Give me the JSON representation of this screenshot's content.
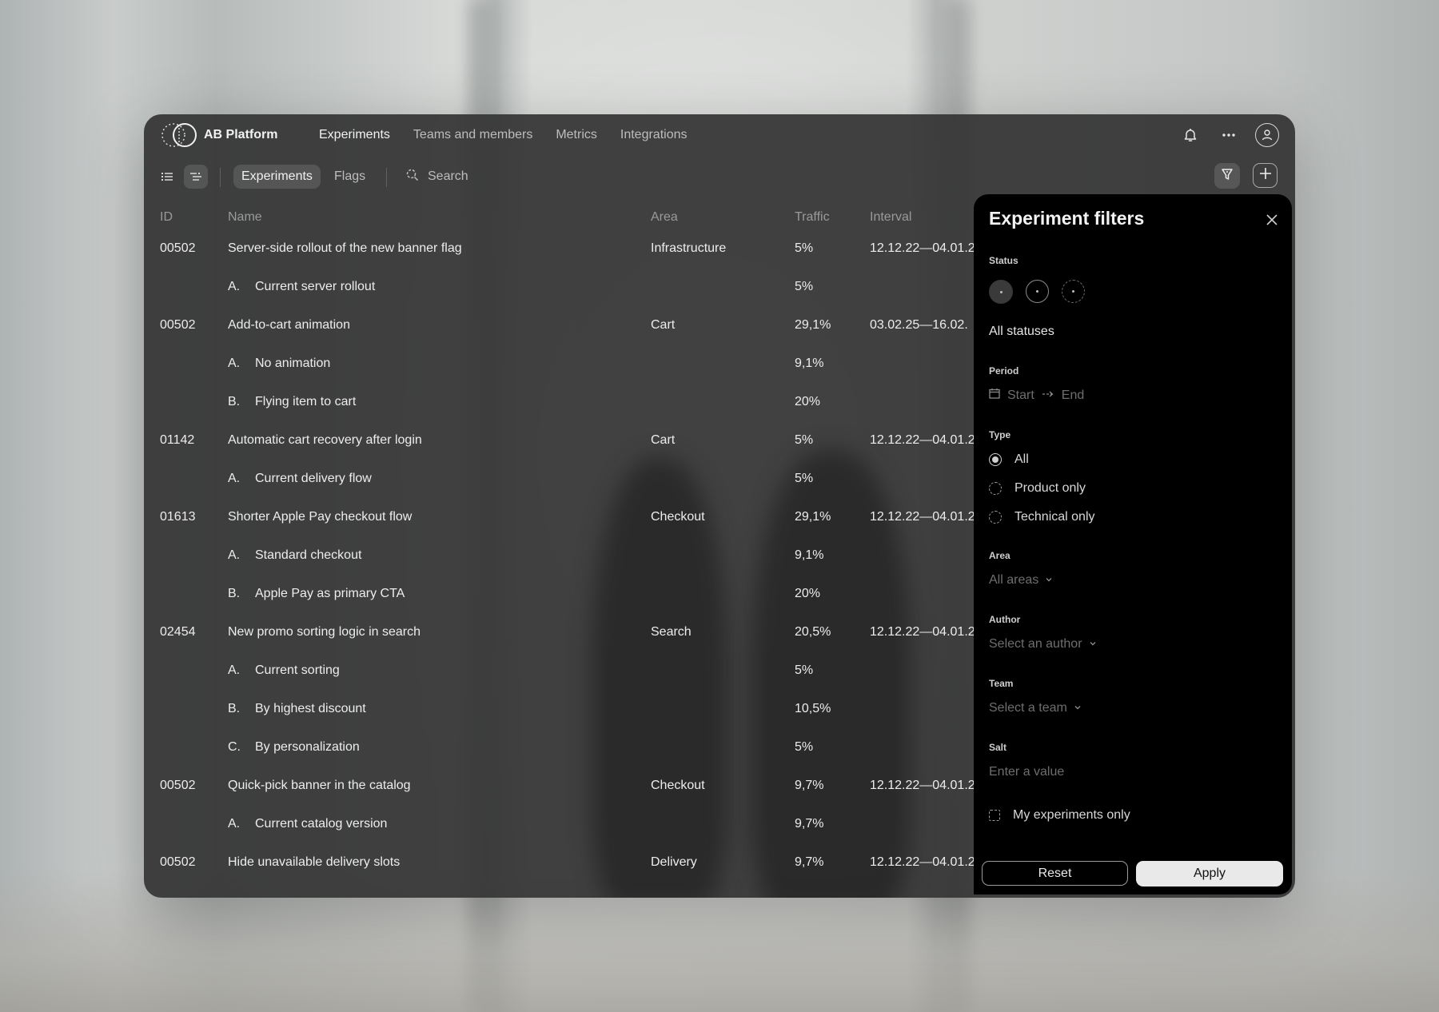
{
  "app": {
    "brand": "AB Platform"
  },
  "nav": {
    "items": [
      "Experiments",
      "Teams and members",
      "Metrics",
      "Integrations"
    ],
    "active": 0
  },
  "toolbar": {
    "segments": [
      "Experiments",
      "Flags"
    ],
    "search_placeholder": "Search"
  },
  "table": {
    "columns": {
      "id": "ID",
      "name": "Name",
      "area": "Area",
      "traffic": "Traffic",
      "interval": "Interval"
    },
    "rows": [
      {
        "type": "experiment",
        "id": "00502",
        "name": "Server-side rollout of the new banner flag",
        "area": "Infrastructure",
        "traffic": "5%",
        "interval": "12.12.22—04.01.2"
      },
      {
        "type": "variant",
        "letter": "A.",
        "name": "Current server rollout",
        "traffic": "5%"
      },
      {
        "type": "experiment",
        "id": "00502",
        "name": "Add-to-cart animation",
        "area": "Cart",
        "traffic": "29,1%",
        "interval": "03.02.25—16.02."
      },
      {
        "type": "variant",
        "letter": "A.",
        "name": "No animation",
        "traffic": "9,1%"
      },
      {
        "type": "variant",
        "letter": "B.",
        "name": "Flying item to cart",
        "traffic": "20%"
      },
      {
        "type": "experiment",
        "id": "01142",
        "name": "Automatic cart recovery after login",
        "area": "Cart",
        "traffic": "5%",
        "interval": "12.12.22—04.01.2"
      },
      {
        "type": "variant",
        "letter": "A.",
        "name": "Current delivery flow",
        "traffic": "5%"
      },
      {
        "type": "experiment",
        "id": "01613",
        "name": "Shorter Apple Pay checkout flow",
        "area": "Checkout",
        "traffic": "29,1%",
        "interval": "12.12.22—04.01.2"
      },
      {
        "type": "variant",
        "letter": "A.",
        "name": "Standard checkout",
        "traffic": "9,1%"
      },
      {
        "type": "variant",
        "letter": "B.",
        "name": "Apple Pay as primary CTA",
        "traffic": "20%"
      },
      {
        "type": "experiment",
        "id": "02454",
        "name": "New promo sorting logic in search",
        "area": "Search",
        "traffic": "20,5%",
        "interval": "12.12.22—04.01.2"
      },
      {
        "type": "variant",
        "letter": "A.",
        "name": "Current sorting",
        "traffic": "5%"
      },
      {
        "type": "variant",
        "letter": "B.",
        "name": "By highest discount",
        "traffic": "10,5%"
      },
      {
        "type": "variant",
        "letter": "C.",
        "name": "By personalization",
        "traffic": "5%"
      },
      {
        "type": "experiment",
        "id": "00502",
        "name": "Quick-pick banner in the catalog",
        "area": "Checkout",
        "traffic": "9,7%",
        "interval": "12.12.22—04.01.2"
      },
      {
        "type": "variant",
        "letter": "A.",
        "name": "Current catalog version",
        "traffic": "9,7%"
      },
      {
        "type": "experiment",
        "id": "00502",
        "name": "Hide unavailable delivery slots",
        "area": "Delivery",
        "traffic": "9,7%",
        "interval": "12.12.22—04.01.2"
      }
    ]
  },
  "filters": {
    "title": "Experiment filters",
    "status": {
      "label": "Status",
      "value": "All statuses"
    },
    "period": {
      "label": "Period",
      "start_placeholder": "Start",
      "end_placeholder": "End"
    },
    "type": {
      "label": "Type",
      "options": [
        "All",
        "Product only",
        "Technical only"
      ],
      "selected": 0
    },
    "area": {
      "label": "Area",
      "placeholder": "All areas"
    },
    "author": {
      "label": "Author",
      "placeholder": "Select an author"
    },
    "team": {
      "label": "Team",
      "placeholder": "Select a team"
    },
    "salt": {
      "label": "Salt",
      "placeholder": "Enter a value"
    },
    "my_only": {
      "label": "My experiments only",
      "checked": false
    },
    "reset_label": "Reset",
    "apply_label": "Apply"
  },
  "icons": [
    "logo-icon",
    "bell-icon",
    "more-icon",
    "user-icon",
    "list-view-icon",
    "tree-view-icon",
    "search-icon",
    "filter-icon",
    "plus-icon",
    "close-icon",
    "calendar-icon",
    "arrow-right-icon",
    "chevron-down-icon"
  ]
}
